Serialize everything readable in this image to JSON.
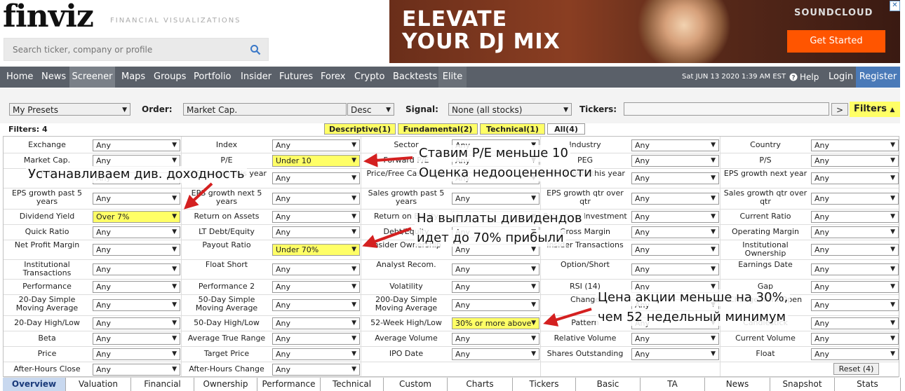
{
  "header": {
    "logo": "finviz",
    "tagline": "FINANCIAL VISUALIZATIONS",
    "search_placeholder": "Search ticker, company or profile"
  },
  "ad": {
    "line1": "ELEVATE",
    "line2": "YOUR DJ MIX",
    "brand": "SOUNDCLOUD",
    "cta": "Get Started",
    "close": "✕"
  },
  "nav": {
    "items": [
      "Home",
      "News",
      "Screener",
      "Maps",
      "Groups",
      "Portfolio",
      "Insider",
      "Futures",
      "Forex",
      "Crypto",
      "Backtests",
      "Elite"
    ],
    "date": "Sat JUN 13 2020 1:39 AM EST",
    "help": "Help",
    "login": "Login",
    "register": "Register"
  },
  "controls": {
    "presets": "My Presets",
    "order_label": "Order:",
    "order": "Market Cap.",
    "direction": "Desc",
    "signal_label": "Signal:",
    "signal": "None (all stocks)",
    "tickers_label": "Tickers:",
    "go": ">",
    "filters_btn": "Filters"
  },
  "filter_tabs": {
    "count_label": "Filters: 4",
    "tabs": [
      "Descriptive(1)",
      "Fundamental(2)",
      "Technical(1)",
      "All(4)"
    ]
  },
  "grid": {
    "rows": [
      [
        [
          "Exchange",
          "Any"
        ],
        [
          "Index",
          "Any"
        ],
        [
          "Sector",
          "Any"
        ],
        [
          "Industry",
          "Any"
        ],
        [
          "Country",
          "Any"
        ]
      ],
      [
        [
          "Market Cap.",
          "Any"
        ],
        [
          "P/E",
          "Under 10"
        ],
        [
          "Forward P/E",
          "Any"
        ],
        [
          "PEG",
          "Any"
        ],
        [
          "P/S",
          "Any"
        ]
      ],
      [
        [
          "P/B",
          "Any"
        ],
        [
          "EPS growth this year",
          "Any"
        ],
        [
          "Price/Free Cash Flow",
          "Any"
        ],
        [
          "EPS growth this year",
          "Any"
        ],
        [
          "EPS growth next year",
          "Any"
        ]
      ],
      [
        [
          "EPS growth past 5 years",
          "Any"
        ],
        [
          "EPS growth next 5 years",
          "Any"
        ],
        [
          "Sales growth past 5 years",
          "Any"
        ],
        [
          "EPS growth qtr over qtr",
          "Any"
        ],
        [
          "Sales growth qtr over qtr",
          "Any"
        ]
      ],
      [
        [
          "Dividend Yield",
          "Over 7%"
        ],
        [
          "Return on Assets",
          "Any"
        ],
        [
          "Return on Equity",
          "Any"
        ],
        [
          "Return on Investment",
          "Any"
        ],
        [
          "Current Ratio",
          "Any"
        ]
      ],
      [
        [
          "Quick Ratio",
          "Any"
        ],
        [
          "LT Debt/Equity",
          "Any"
        ],
        [
          "Debt/Equity",
          "Any"
        ],
        [
          "Gross Margin",
          "Any"
        ],
        [
          "Operating Margin",
          "Any"
        ]
      ],
      [
        [
          "Net Profit Margin",
          "Any"
        ],
        [
          "Payout Ratio",
          "Under 70%"
        ],
        [
          "Insider Ownership",
          "Any"
        ],
        [
          "Insider Transactions",
          "Any"
        ],
        [
          "Institutional Ownership",
          "Any"
        ]
      ],
      [
        [
          "Institutional Transactions",
          "Any"
        ],
        [
          "Float Short",
          "Any"
        ],
        [
          "Analyst Recom.",
          "Any"
        ],
        [
          "Option/Short",
          "Any"
        ],
        [
          "Earnings Date",
          "Any"
        ]
      ],
      [
        [
          "Performance",
          "Any"
        ],
        [
          "Performance 2",
          "Any"
        ],
        [
          "Volatility",
          "Any"
        ],
        [
          "RSI (14)",
          "Any"
        ],
        [
          "Gap",
          "Any"
        ]
      ],
      [
        [
          "20-Day Simple Moving Average",
          "Any"
        ],
        [
          "50-Day Simple Moving Average",
          "Any"
        ],
        [
          "200-Day Simple Moving Average",
          "Any"
        ],
        [
          "Change",
          "Any"
        ],
        [
          "Change from Open",
          "Any"
        ]
      ],
      [
        [
          "20-Day High/Low",
          "Any"
        ],
        [
          "50-Day High/Low",
          "Any"
        ],
        [
          "52-Week High/Low",
          "30% or more above"
        ],
        [
          "Pattern",
          "Any"
        ],
        [
          "Candlestick",
          "Any"
        ]
      ],
      [
        [
          "Beta",
          "Any"
        ],
        [
          "Average True Range",
          "Any"
        ],
        [
          "Average Volume",
          "Any"
        ],
        [
          "Relative Volume",
          "Any"
        ],
        [
          "Current Volume",
          "Any"
        ]
      ],
      [
        [
          "Price",
          "Any"
        ],
        [
          "Target Price",
          "Any"
        ],
        [
          "IPO Date",
          "Any"
        ],
        [
          "Shares Outstanding",
          "Any"
        ],
        [
          "Float",
          "Any"
        ]
      ],
      [
        [
          "After-Hours Close",
          "Any"
        ],
        [
          "After-Hours Change",
          "Any"
        ],
        null,
        null,
        null
      ]
    ],
    "reset": "Reset (4)"
  },
  "bottom_tabs": [
    "Overview",
    "Valuation",
    "Financial",
    "Ownership",
    "Performance",
    "Technical",
    "Custom",
    "Charts",
    "Tickers",
    "Basic",
    "TA",
    "News",
    "Snapshot",
    "Stats"
  ],
  "annotations": {
    "pe1": "Ставим P/E меньше 10",
    "pe2": "Оценка недооцененности",
    "div": "Устанавливаем див. доходность",
    "pay1": "На выплаты дивидендов",
    "pay2": "идет до 70% прибыли",
    "hl1": "Цена акции меньше на 30%,",
    "hl2": "чем 52 недельный минимум"
  },
  "colors": {
    "nav_bg": "#5a6069",
    "highlight": "#ffff66",
    "tab_yellow": "#ffff66",
    "arrow": "#d42020",
    "register_bg": "#4a7ab8"
  }
}
